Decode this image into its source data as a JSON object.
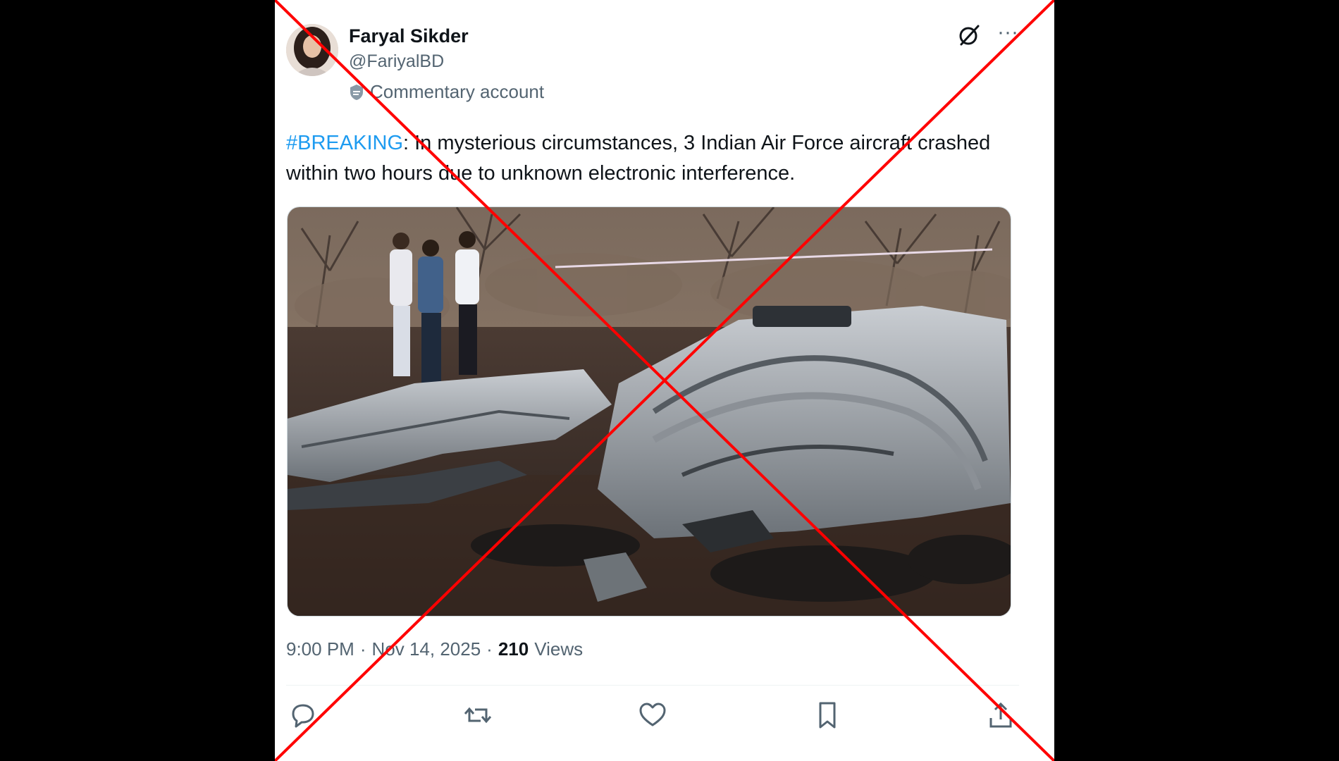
{
  "tweet": {
    "author": {
      "display_name": "Faryal Sikder",
      "handle": "@FariyalBD",
      "label": "Commentary account"
    },
    "text": {
      "hashtag": "#BREAKING",
      "body": ": In mysterious circumstances, 3 Indian Air Force aircraft crashed within two hours due to unknown electronic interference."
    },
    "meta": {
      "time": "9:00 PM",
      "date": "Nov 14, 2025",
      "views_count": "210",
      "views_label": "Views"
    },
    "more_glyph": "···"
  },
  "icons": {
    "grok": "grok-icon",
    "more": "more-icon",
    "reply": "reply-icon",
    "retweet": "retweet-icon",
    "like": "heart-icon",
    "bookmark": "bookmark-icon",
    "share": "share-icon",
    "label": "shield-icon"
  },
  "colors": {
    "link": "#1d9bf0",
    "secondary_text": "#536471",
    "primary_text": "#0f1419",
    "overlay_cross": "#ff0000",
    "background": "#000000",
    "card": "#ffffff"
  }
}
